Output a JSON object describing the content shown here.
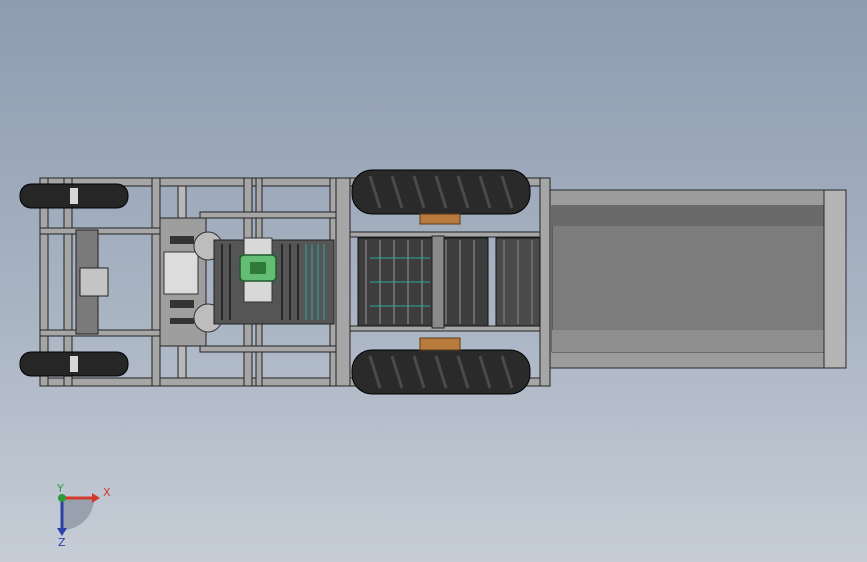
{
  "viewport": {
    "name": "cad-graphics-area",
    "background_top": "#8e9cb0",
    "background_bottom": "#c6cdd6"
  },
  "colors": {
    "frame": "#9a9a9a",
    "frame_edge": "#2a2a2a",
    "tire": "#2b2b2b",
    "hub": "#b87a3d",
    "bin": "#8c8c8c",
    "bin_dark": "#6b6b6b",
    "accent_green": "#5ab56a",
    "accent_teal": "#2aa7a7"
  },
  "triad": {
    "x_label": "X",
    "y_label": "Y",
    "z_label": "Z",
    "x_color": "#d23b2b",
    "y_color": "#2e9b3a",
    "z_color": "#2d3fa8"
  }
}
